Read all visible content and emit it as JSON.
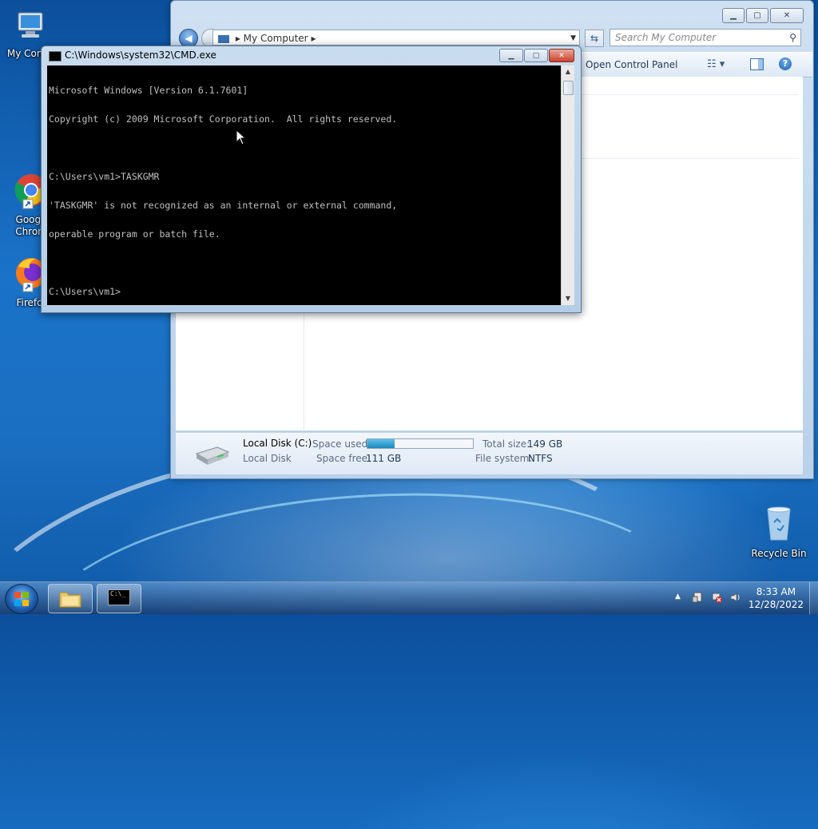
{
  "desktop": {
    "icons": [
      {
        "label": "My Comp"
      },
      {
        "label": "Googl\nChron"
      },
      {
        "label": "Firefo"
      },
      {
        "label": "Recycle Bin"
      }
    ]
  },
  "explorer": {
    "address": "My Computer",
    "search_placeholder": "Search My Computer",
    "toolbar": {
      "open_control_panel": "Open Control Panel"
    },
    "details": {
      "drive_name": "Local Disk (C:)",
      "drive_type": "Local Disk",
      "space_used_label": "Space used:",
      "space_used_fraction": 0.255,
      "space_free_label": "Space free:",
      "space_free_value": "111 GB",
      "total_size_label": "Total size:",
      "total_size_value": "149 GB",
      "file_system_label": "File system:",
      "file_system_value": "NTFS"
    }
  },
  "cmd": {
    "title": "C:\\Windows\\system32\\CMD.exe",
    "lines": [
      "Microsoft Windows [Version 6.1.7601]",
      "Copyright (c) 2009 Microsoft Corporation.  All rights reserved.",
      "",
      "C:\\Users\\vm1>TASKGMR",
      "'TASKGMR' is not recognized as an internal or external command,",
      "operable program or batch file.",
      "",
      "C:\\Users\\vm1>"
    ]
  },
  "taskbar": {
    "time": "8:33 AM",
    "date": "12/28/2022"
  },
  "colors": {
    "console_bg": "#000000",
    "console_fg": "#c0c0c0",
    "desktop_blue": "#1a73c9"
  }
}
